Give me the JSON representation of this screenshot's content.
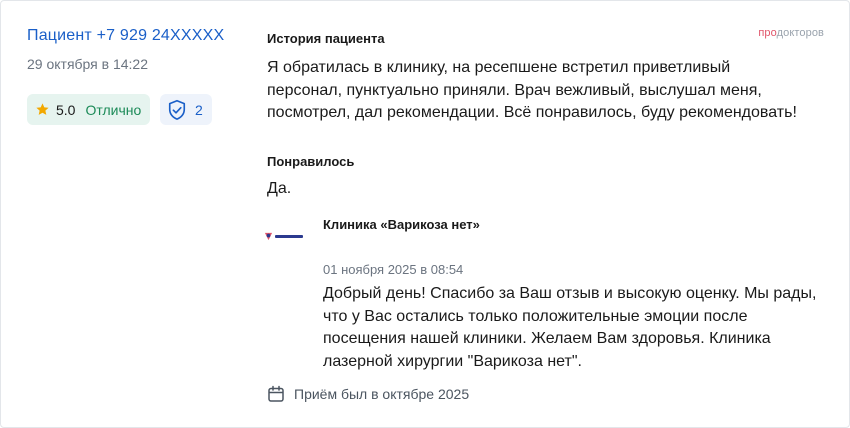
{
  "author": {
    "name": "Пациент +7 929 24XXXXX",
    "date": "29 октября в 14:22"
  },
  "rating": {
    "value": "5.0",
    "label": "Отлично",
    "icon": "star-icon",
    "color": "#f2a800"
  },
  "verification": {
    "count": "2",
    "icon": "shield-check-icon"
  },
  "brand": {
    "prefix": "про",
    "name": "докторов"
  },
  "sections": {
    "history_title": "История пациента",
    "history_text": "Я обратилась в клинику, на ресепшене встретил приветливый персонал, пунктуально приняли. Врач вежливый, выслушал меня, посмотрел, дал рекомендации. Всё понравилось, буду рекомендовать!",
    "liked_title": "Понравилось",
    "liked_text": "Да."
  },
  "reply": {
    "author": "Клиника «Варикоза нет»",
    "date": "01 ноября 2025 в 08:54",
    "text": "Добрый день! Спасибо за Ваш отзыв и высокую оценку. Мы рады, что у Вас остались только положительные эмоции после посещения нашей клиники. Желаем Вам здоровья. Клиника лазерной хирургии \"Варикоза нет\".",
    "logo_icon": "clinic-logo"
  },
  "visit": {
    "text": "Приём был в октябре 2025",
    "icon": "calendar-icon"
  },
  "colors": {
    "link": "#1a5fc8",
    "positive": "#1b8a57",
    "badge_bg": "#e6f4ef",
    "brand_accent": "#e0556a"
  }
}
